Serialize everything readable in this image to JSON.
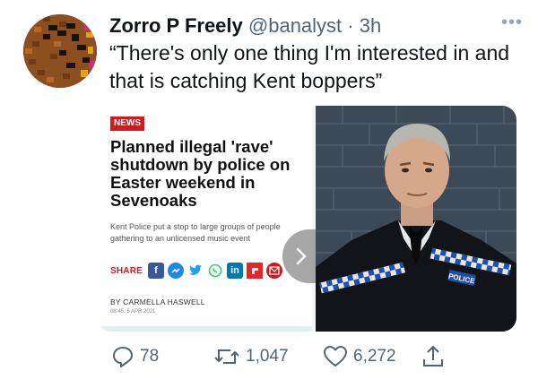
{
  "tweet": {
    "display_name": "Zorro P Freely",
    "handle": "@banalyst",
    "separator": "·",
    "time": "3h",
    "more": "•••",
    "text": "“There's only one thing I'm interested in and that is catching Kent boppers”"
  },
  "article": {
    "badge": "NEWS",
    "headline": "Planned illegal 'rave' shutdown by police on Easter weekend in Sevenoaks",
    "standfirst": "Kent Police put a stop to large groups of people gathering to an unlicensed music event",
    "share_label": "SHARE",
    "share_icons": [
      "facebook-icon",
      "messenger-icon",
      "twitter-icon",
      "whatsapp-icon",
      "linkedin-icon",
      "flipboard-icon",
      "email-icon"
    ],
    "byline": "BY CARMELLA HASWELL",
    "dateline": "08:45, 5 APR 2021"
  },
  "photo": {
    "vest_text": "POLICE"
  },
  "actions": {
    "replies": "78",
    "retweets": "1,047",
    "likes": "6,272"
  },
  "colors": {
    "text": "#0f1419",
    "muted": "#536471",
    "news_red": "#d1191e"
  }
}
